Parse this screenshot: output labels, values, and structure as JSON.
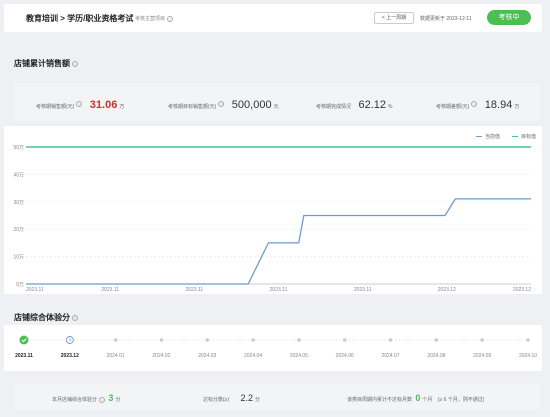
{
  "header": {
    "title": "教育培训 > 学历/职业资格考试",
    "subtitle": "考核主营项目",
    "prev_button": "< 上一周期",
    "updated": "数据更新于 2023-12-11",
    "status": "考核中"
  },
  "sales_section": {
    "title": "店铺累计销售额",
    "stats": [
      {
        "label": "考核期销售额(元)",
        "value": "31.06",
        "unit": "万"
      },
      {
        "label": "考核期目标销售额(元)",
        "value": "500,000",
        "unit": "元"
      },
      {
        "label": "考核期完成情况",
        "value": "62.12",
        "unit": "%"
      },
      {
        "label": "考核期差额(元)",
        "value": "18.94",
        "unit": "万"
      }
    ]
  },
  "chart_data": {
    "type": "line",
    "legend": [
      "当前值",
      "目标值"
    ],
    "y_ticks": [
      "0万",
      "10万",
      "20万",
      "30万",
      "40万",
      "50万"
    ],
    "x_ticks": [
      "2023.11",
      "2023.11",
      "2023.11",
      "2023.11",
      "2023.11",
      "2023.12",
      "2023.12"
    ],
    "ylim": [
      0,
      50
    ],
    "series": [
      {
        "name": "当前值",
        "color": "#6b9bd1",
        "x": [
          0,
          0.18,
          0.44,
          0.48,
          0.54,
          0.55,
          0.65,
          0.67,
          0.74,
          0.76,
          0.83,
          0.85,
          1.0
        ],
        "values": [
          0,
          0,
          0,
          15,
          15,
          25,
          25,
          25,
          25,
          25,
          25,
          31.06,
          31.06
        ]
      },
      {
        "name": "目标值",
        "color": "#3ec4a6",
        "x": [
          0,
          1
        ],
        "values": [
          50,
          50
        ]
      }
    ]
  },
  "score_section": {
    "title": "店铺综合体验分",
    "timeline": [
      "2023.11",
      "2023.12",
      "2024.01",
      "2024.02",
      "2024.03",
      "2024.04",
      "2024.05",
      "2024.06",
      "2024.07",
      "2024.08",
      "2024.09",
      "2024.10"
    ],
    "bottom": {
      "current_label": "本月店铺综合体验分",
      "current_value": "3",
      "current_unit": "分",
      "pass_label": "达标分数(≥)",
      "pass_value": "2.2",
      "pass_unit": "分",
      "fail_label": "该类目周期内累计不达标月数",
      "fail_value": "0",
      "fail_unit": "个月",
      "fail_note": "(≥ 6 个月，则不通过)"
    }
  },
  "colors": {
    "accent_green": "#4cbf52",
    "red": "#d0312d",
    "line_blue": "#6b9bd1",
    "line_teal": "#3ec4a6"
  }
}
